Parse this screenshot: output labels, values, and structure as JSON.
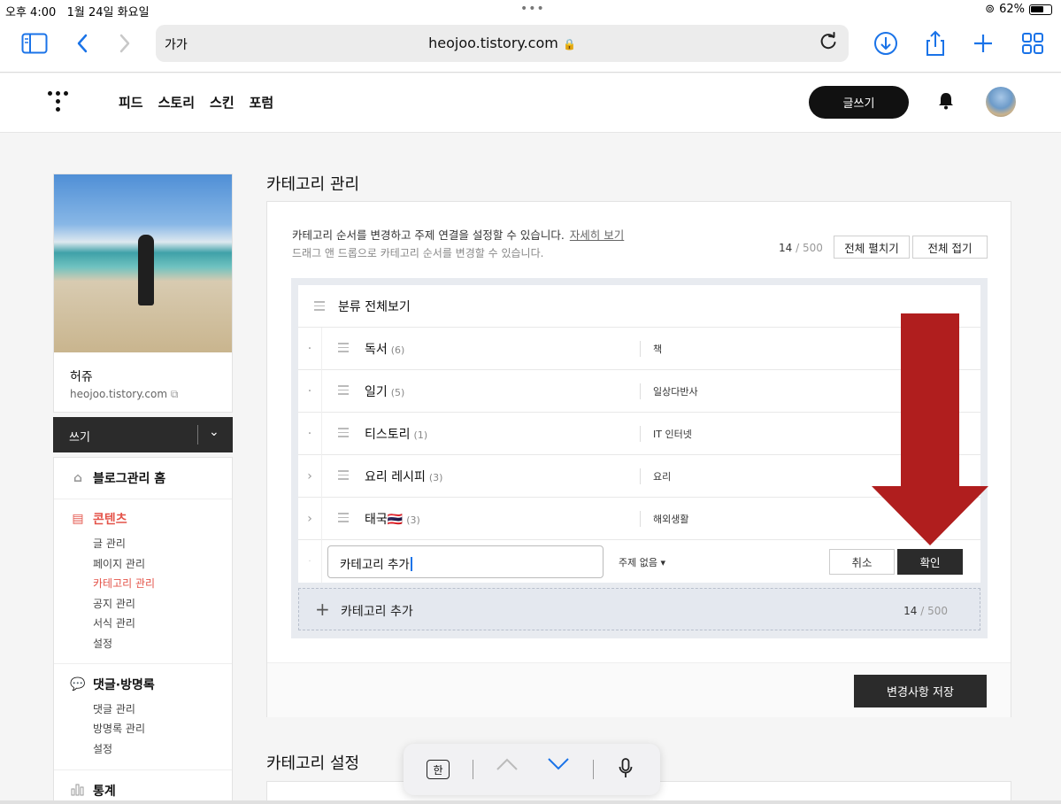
{
  "status_bar": {
    "time": "오후 4:00",
    "date": "1월 24일 화요일",
    "battery": "62%"
  },
  "browser": {
    "text_size": "가가",
    "url": "heojoo.tistory.com"
  },
  "header": {
    "nav": [
      "피드",
      "스토리",
      "스킨",
      "포럼"
    ],
    "write_label": "글쓰기"
  },
  "profile": {
    "name": "허쥬",
    "url": "heojoo.tistory.com"
  },
  "sidebar": {
    "write_label": "쓰기",
    "blog_home": "블로그관리 홈",
    "contents": {
      "title": "콘텐츠",
      "items": [
        "글 관리",
        "페이지 관리",
        "카테고리 관리",
        "공지 관리",
        "서식 관리",
        "설정"
      ]
    },
    "comments": {
      "title": "댓글·방명록",
      "items": [
        "댓글 관리",
        "방명록 관리",
        "설정"
      ]
    },
    "stats": {
      "title": "통계"
    }
  },
  "main": {
    "title": "카테고리 관리",
    "desc_line1": "카테고리 순서를 변경하고 주제 연결을 설정할 수 있습니다.",
    "detail_link": "자세히 보기",
    "desc_line2": "드래그 앤 드롭으로 카테고리 순서를 변경할 수 있습니다.",
    "count": "14",
    "count_total": "/ 500",
    "expand_all": "전체 펼치기",
    "collapse_all": "전체 접기",
    "root_category": "분류 전체보기",
    "categories": [
      {
        "expander": "·",
        "name": "독서",
        "count": "(6)",
        "topic": "책"
      },
      {
        "expander": "·",
        "name": "일기",
        "count": "(5)",
        "topic": "일상다반사"
      },
      {
        "expander": "·",
        "name": "티스토리",
        "count": "(1)",
        "topic": "IT 인터넷"
      },
      {
        "expander": "›",
        "name": "요리 레시피",
        "count": "(3)",
        "topic": "요리"
      },
      {
        "expander": "›",
        "name": "태국🇹🇭",
        "count": "(3)",
        "topic": "해외생활"
      }
    ],
    "edit": {
      "input_value": "카테고리 추가",
      "topic": "주제 없음 ▾",
      "cancel": "취소",
      "confirm": "확인"
    },
    "add_label": "카테고리 추가",
    "add_count": "14",
    "add_count_total": "/ 500",
    "save": "변경사항 저장",
    "settings_title": "카테고리 설정"
  },
  "keyboard_bar": {
    "han": "한"
  },
  "colors": {
    "accent": "#e4544a",
    "annotation_arrow": "#b01e1e",
    "dark_button": "#2b2b2b"
  }
}
